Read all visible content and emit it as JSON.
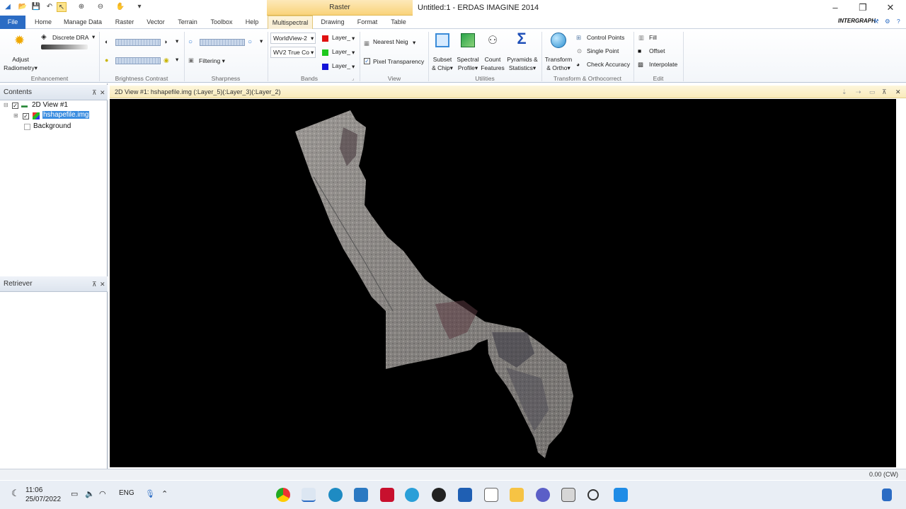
{
  "title_bar": {
    "window_title": "Untitled:1 - ERDAS IMAGINE 2014",
    "contextual_tab": "Raster",
    "minimize": "–",
    "restore": "❐",
    "close": "✕"
  },
  "tabs": {
    "file": "File",
    "items": [
      "Home",
      "Manage Data",
      "Raster",
      "Vector",
      "Terrain",
      "Toolbox",
      "Help",
      "Multispectral",
      "Drawing",
      "Format",
      "Table"
    ],
    "active": "Multispectral"
  },
  "ribbon": {
    "enhancement": {
      "label": "Enhancement",
      "discrete_dra": "Discrete DRA",
      "adjust": "Adjust",
      "radiometry": "Radiometry"
    },
    "brightness_contrast": {
      "label": "Brightness Contrast"
    },
    "sharpness": {
      "label": "Sharpness",
      "filtering": "Filtering"
    },
    "bands": {
      "label": "Bands",
      "sensor": "WorldView-2",
      "combo": "WV2 True Co",
      "red": "Layer_",
      "green": "Layer_",
      "blue": "Layer_",
      "colors": {
        "red": "#e01010",
        "green": "#1ec81e",
        "blue": "#1414d8"
      }
    },
    "view": {
      "label": "View",
      "resample": "Nearest Neig",
      "pixel_transparency": "Pixel Transparency"
    },
    "utilities": {
      "label": "Utilities",
      "subset": [
        "Subset",
        "& Chip"
      ],
      "spectral": [
        "Spectral",
        "Profile"
      ],
      "count": [
        "Count",
        "Features"
      ],
      "pyramids": [
        "Pyramids &",
        "Statistics"
      ]
    },
    "transform": {
      "label": "Transform & Orthocorrect",
      "transform": [
        "Transform",
        "& Ortho"
      ],
      "control_points": "Control Points",
      "single_point": "Single Point",
      "check_accuracy": "Check Accuracy"
    },
    "edit": {
      "label": "Edit",
      "fill": "Fill",
      "offset": "Offset",
      "interpolate": "Interpolate"
    }
  },
  "contents_panel": {
    "title": "Contents",
    "tree": {
      "view": "2D View #1",
      "layer": "hshapefile.img",
      "background": "Background"
    }
  },
  "retriever_panel": {
    "title": "Retriever"
  },
  "viewer": {
    "header": "2D View #1: hshapefile.img (:Layer_5)(:Layer_3)(:Layer_2)"
  },
  "status_bar": {
    "right": "0.00 (CW)"
  },
  "taskbar": {
    "time": "11:06",
    "date": "25/07/2022",
    "lang": "ENG"
  }
}
